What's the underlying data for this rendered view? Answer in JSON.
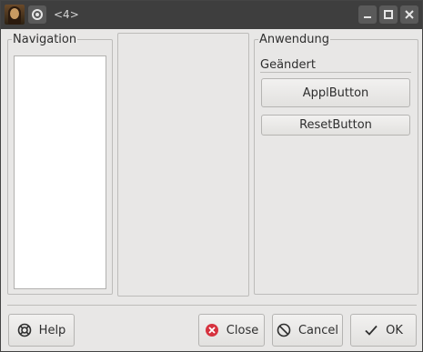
{
  "window": {
    "title": "<4>"
  },
  "navigation": {
    "title": "Navigation"
  },
  "application": {
    "title": "Anwendung",
    "changed_label": "Geändert",
    "apply_button": "ApplButton",
    "reset_button": "ResetButton"
  },
  "buttons": {
    "help": "Help",
    "close": "Close",
    "cancel": "Cancel",
    "ok": "OK"
  },
  "colors": {
    "titlebar": "#3e3e3e",
    "background": "#e8e7e6",
    "close_icon": "#d6333f"
  }
}
